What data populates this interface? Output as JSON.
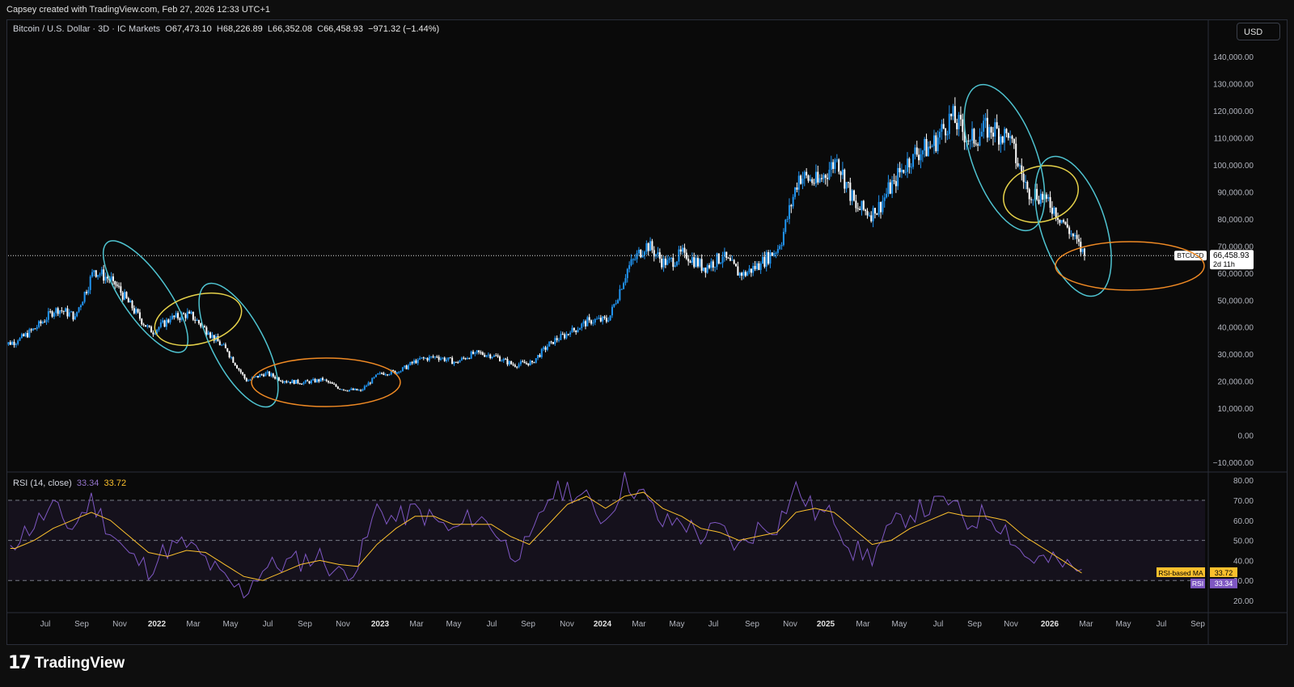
{
  "header": {
    "credit": "Capsey created with TradingView.com, Feb 27, 2026 12:33 UTC+1"
  },
  "symbol": {
    "name": "Bitcoin / U.S. Dollar · 3D · IC Markets",
    "open_label": "O",
    "open": "67,473.10",
    "high_label": "H",
    "high": "68,226.89",
    "low_label": "L",
    "low": "66,352.08",
    "close_label": "C",
    "close": "66,458.93",
    "change": "−971.32 (−1.44%)",
    "ticker": "BTCUSD",
    "last_price": "66,458.93",
    "countdown": "2d 11h"
  },
  "currency_button": "USD",
  "rsi": {
    "title": "RSI (14, close)",
    "rsi_value": "33.34",
    "ma_value": "33.72",
    "ma_label": "RSI-based MA",
    "rsi_label": "RSI"
  },
  "price_axis": [
    "140,000.00",
    "130,000.00",
    "120,000.00",
    "110,000.00",
    "100,000.00",
    "90,000.00",
    "80,000.00",
    "70,000.00",
    "60,000.00",
    "50,000.00",
    "40,000.00",
    "30,000.00",
    "20,000.00",
    "10,000.00",
    "0.00",
    "−10,000.00"
  ],
  "rsi_axis": [
    "80.00",
    "70.00",
    "60.00",
    "50.00",
    "40.00",
    "30.00",
    "20.00"
  ],
  "time_axis": [
    "Jul",
    "Sep",
    "Nov",
    "2022",
    "Mar",
    "May",
    "Jul",
    "Sep",
    "Nov",
    "2023",
    "Mar",
    "May",
    "Jul",
    "Sep",
    "Nov",
    "2024",
    "Mar",
    "May",
    "Jul",
    "Sep",
    "Nov",
    "2025",
    "Mar",
    "May",
    "Jul",
    "Sep",
    "Nov",
    "2026",
    "Mar",
    "May",
    "Jul",
    "Sep"
  ],
  "brand": "TradingView",
  "colors": {
    "up": "#2196f3",
    "down": "#ffffff",
    "rsi": "#7e57c2",
    "rsi_ma": "#fbc02d",
    "cyan": "#4fc3d0",
    "yellow": "#e6d24a",
    "orange": "#f08a24"
  },
  "chart_data": [
    {
      "type": "candlestick",
      "ylim": [
        -10000,
        140000
      ],
      "x": [
        "2021-06",
        "2021-07",
        "2021-08",
        "2021-09",
        "2021-10",
        "2021-11",
        "2021-12",
        "2022-01",
        "2022-02",
        "2022-03",
        "2022-04",
        "2022-05",
        "2022-06",
        "2022-07",
        "2022-08",
        "2022-09",
        "2022-10",
        "2022-11",
        "2022-12",
        "2023-01",
        "2023-02",
        "2023-03",
        "2023-04",
        "2023-05",
        "2023-06",
        "2023-07",
        "2023-08",
        "2023-09",
        "2023-10",
        "2023-11",
        "2023-12",
        "2024-01",
        "2024-02",
        "2024-03",
        "2024-04",
        "2024-05",
        "2024-06",
        "2024-07",
        "2024-08",
        "2024-09",
        "2024-10",
        "2024-11",
        "2024-12",
        "2025-01",
        "2025-02",
        "2025-03",
        "2025-04",
        "2025-05",
        "2025-06",
        "2025-07",
        "2025-08",
        "2025-09",
        "2025-10",
        "2025-11",
        "2025-12",
        "2026-01",
        "2026-02"
      ],
      "close": [
        35000,
        40000,
        47000,
        44000,
        61000,
        57000,
        47000,
        38000,
        43000,
        45000,
        38000,
        31000,
        20000,
        23000,
        20000,
        19500,
        20500,
        17000,
        16500,
        23000,
        23500,
        28000,
        29000,
        27000,
        30500,
        29500,
        26000,
        27000,
        34500,
        38000,
        42500,
        42500,
        61500,
        71000,
        63000,
        67500,
        62000,
        66000,
        59000,
        63500,
        70000,
        96000,
        93500,
        102000,
        84000,
        82000,
        94000,
        104000,
        107000,
        118000,
        109000,
        114000,
        110000,
        91000,
        87500,
        78000,
        66458
      ]
    },
    {
      "type": "line",
      "ylim": [
        15,
        85
      ],
      "x": [
        "2021-06",
        "2021-07",
        "2021-08",
        "2021-09",
        "2021-10",
        "2021-11",
        "2021-12",
        "2022-01",
        "2022-02",
        "2022-03",
        "2022-04",
        "2022-05",
        "2022-06",
        "2022-07",
        "2022-08",
        "2022-09",
        "2022-10",
        "2022-11",
        "2022-12",
        "2023-01",
        "2023-02",
        "2023-03",
        "2023-04",
        "2023-05",
        "2023-06",
        "2023-07",
        "2023-08",
        "2023-09",
        "2023-10",
        "2023-11",
        "2023-12",
        "2024-01",
        "2024-02",
        "2024-03",
        "2024-04",
        "2024-05",
        "2024-06",
        "2024-07",
        "2024-08",
        "2024-09",
        "2024-10",
        "2024-11",
        "2024-12",
        "2025-01",
        "2025-02",
        "2025-03",
        "2025-04",
        "2025-05",
        "2025-06",
        "2025-07",
        "2025-08",
        "2025-09",
        "2025-10",
        "2025-11",
        "2025-12",
        "2026-01",
        "2026-02"
      ],
      "series": [
        {
          "name": "RSI",
          "values": [
            50,
            58,
            66,
            56,
            70,
            55,
            42,
            36,
            46,
            48,
            40,
            30,
            24,
            36,
            38,
            40,
            42,
            33,
            38,
            66,
            60,
            65,
            60,
            54,
            62,
            58,
            44,
            47,
            72,
            76,
            70,
            60,
            80,
            72,
            58,
            60,
            52,
            56,
            46,
            56,
            58,
            76,
            64,
            62,
            45,
            42,
            56,
            64,
            66,
            70,
            58,
            64,
            56,
            42,
            40,
            38,
            33.34
          ]
        },
        {
          "name": "RSI-based MA",
          "values": [
            46,
            50,
            56,
            60,
            64,
            60,
            52,
            44,
            42,
            45,
            44,
            38,
            32,
            30,
            34,
            38,
            40,
            38,
            37,
            48,
            56,
            62,
            62,
            58,
            58,
            58,
            52,
            48,
            58,
            68,
            72,
            66,
            72,
            74,
            66,
            62,
            56,
            54,
            50,
            52,
            54,
            64,
            66,
            64,
            56,
            48,
            50,
            56,
            60,
            64,
            62,
            62,
            60,
            52,
            46,
            40,
            33.72
          ]
        }
      ],
      "hlines": [
        70,
        50,
        30
      ]
    }
  ]
}
